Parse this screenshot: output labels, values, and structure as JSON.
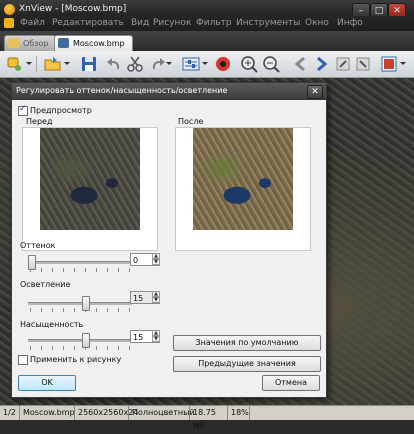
{
  "window": {
    "title": "XnView - [Moscow.bmp]",
    "controls": {
      "minimize": "–",
      "maximize": "□",
      "close": "✕"
    }
  },
  "menu": [
    "Файл",
    "Редактировать",
    "Вид",
    "Рисунок",
    "Фильтр",
    "Инструменты",
    "Окно",
    "Инфо"
  ],
  "tabs": [
    {
      "label": "Обзор",
      "active": false
    },
    {
      "label": "Moscow.bmp",
      "active": true
    }
  ],
  "toolbar": {
    "icons": [
      "tag-icon",
      "folder-open-icon",
      "save-icon",
      "undo-icon",
      "cut-icon",
      "redo-icon",
      "settings-icon",
      "color-icon",
      "zoom-in-icon",
      "zoom-out-icon",
      "arrow-left-icon",
      "arrow-right-icon",
      "first-icon",
      "last-icon",
      "fullscreen-icon"
    ]
  },
  "dialog": {
    "title": "Регулировать оттенок/насыщенность/осветление",
    "close": "✕",
    "preview_label": "Предпросмотр",
    "preview_checked": true,
    "before_label": "Перед",
    "after_label": "После",
    "hue": {
      "label": "Оттенок",
      "value": "0",
      "position": 0.0
    },
    "lightness": {
      "label": "Осветление",
      "value": "15",
      "position": 0.55
    },
    "saturation": {
      "label": "Насыщенность",
      "value": "15",
      "position": 0.55
    },
    "apply_to_image_label": "Применить к рисунку",
    "apply_checked": false,
    "defaults_button": "Значения по умолчанию",
    "previous_button": "Предыдущие значения",
    "ok_button": "OK",
    "cancel_button": "Отмена"
  },
  "status": {
    "page": "1/2",
    "filename": "Moscow.bmp",
    "dimensions": "2560x2560x24",
    "color_mode": "Полноцветный",
    "size": "18.75 Мб",
    "zoom": "18%"
  },
  "colors": {
    "accent": "#3c7fb1",
    "titlebar": "#2b2b2b",
    "dialog_bg": "#f0f0f0"
  }
}
